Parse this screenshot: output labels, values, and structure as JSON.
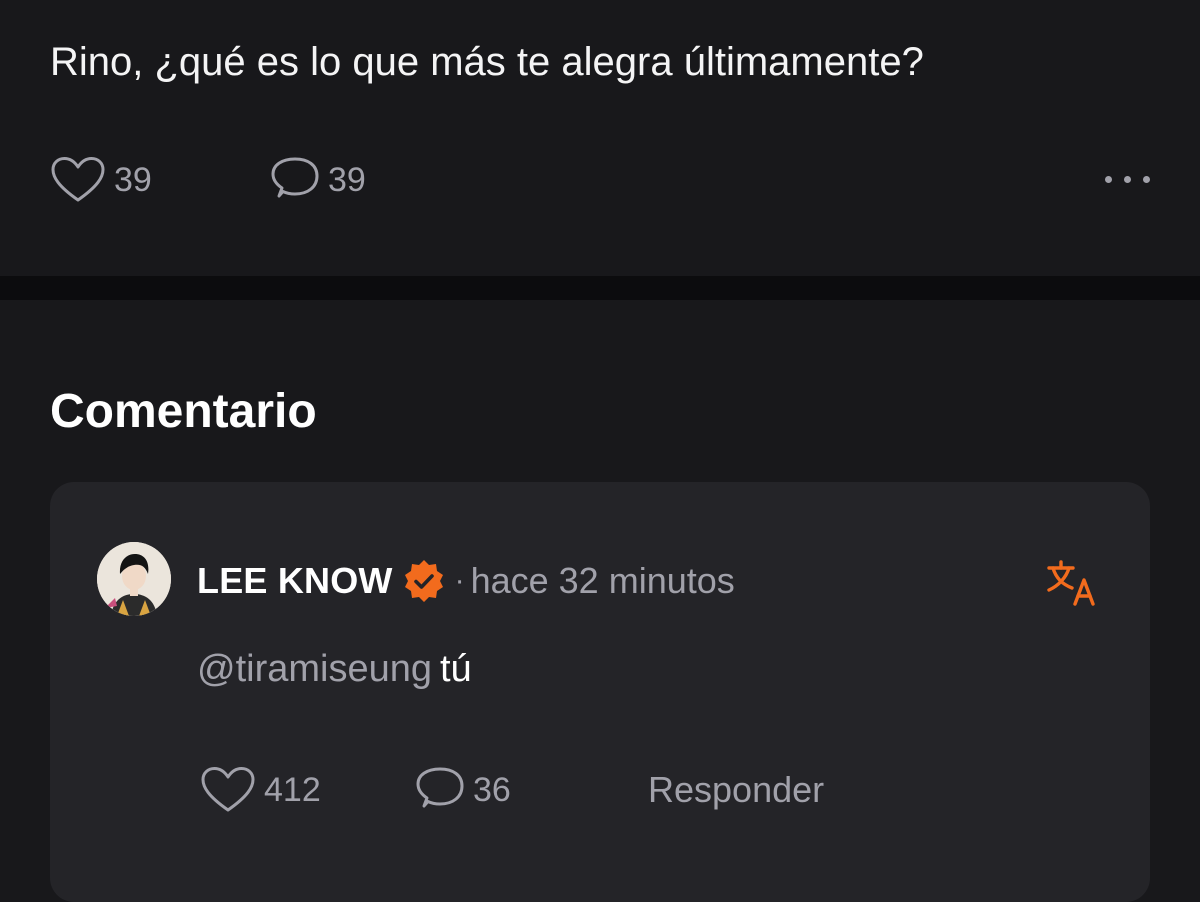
{
  "post": {
    "text": "Rino, ¿qué es lo que más te alegra últimamente?",
    "likes": "39",
    "comments": "39",
    "more_icon": "more-horizontal-icon"
  },
  "comments_section": {
    "title": "Comentario",
    "comment": {
      "author": "LEE KNOW",
      "verified_color": "#f26b1d",
      "separator": "·",
      "time": "hace 32 minutos",
      "mention": "@tiramiseung",
      "text": "tú",
      "likes": "412",
      "replies": "36",
      "reply_label": "Responder",
      "translate_icon": "translate-icon",
      "accent": "#f26b1d"
    }
  }
}
